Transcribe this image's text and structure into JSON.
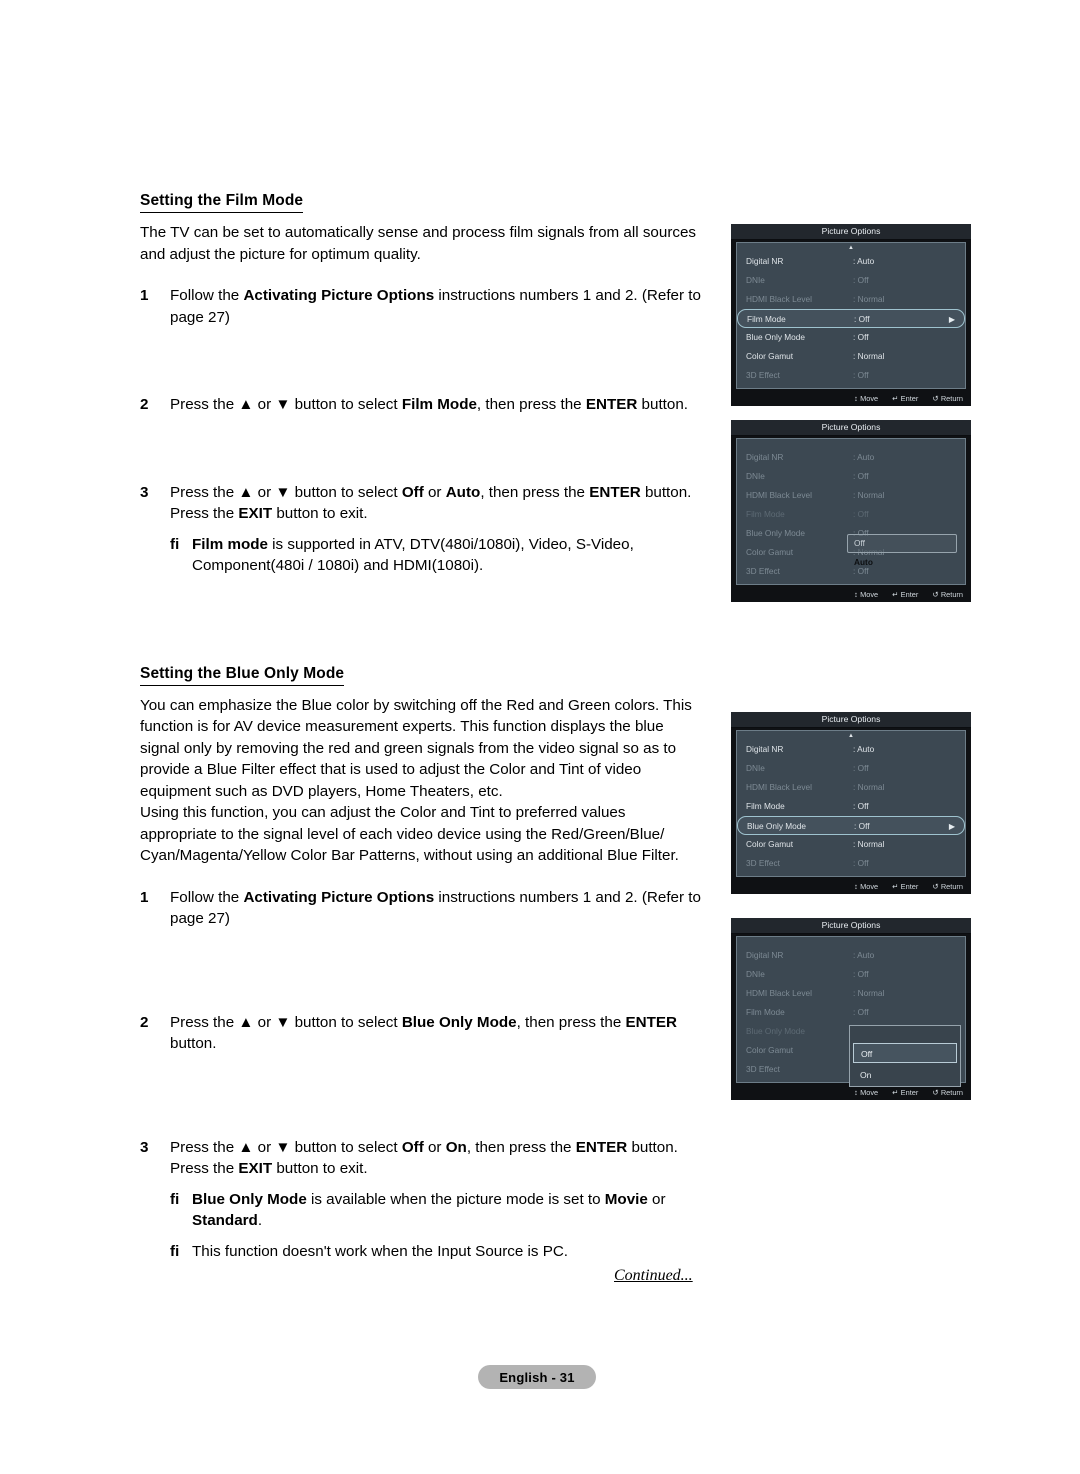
{
  "document": {
    "page_badge": "English - 31",
    "continued": "Continued...",
    "sections": [
      {
        "title": "Setting the Film Mode",
        "intro": "The TV can be set to automatically sense and process film signals from all sources and adjust the picture for optimum quality.",
        "steps": [
          {
            "num": "1",
            "text_parts": [
              {
                "t": "Follow the ",
                "b": false
              },
              {
                "t": "Activating Picture Options",
                "b": true
              },
              {
                "t": " instructions numbers 1 and 2. (Refer to page 27)",
                "b": false
              }
            ]
          },
          {
            "num": "2",
            "text_parts": [
              {
                "t": "Press the ▲ or ▼ button to select ",
                "b": false
              },
              {
                "t": "Film Mode",
                "b": true
              },
              {
                "t": ", then press the ",
                "b": false
              },
              {
                "t": "ENTER",
                "b": true
              },
              {
                "t": " button.",
                "b": false
              }
            ]
          },
          {
            "num": "3",
            "text_parts": [
              {
                "t": "Press the ▲ or ▼ button to select ",
                "b": false
              },
              {
                "t": "Off",
                "b": true
              },
              {
                "t": " or ",
                "b": false
              },
              {
                "t": "Auto",
                "b": true
              },
              {
                "t": ", then press the ",
                "b": false
              },
              {
                "t": "ENTER",
                "b": true
              },
              {
                "t": " button. Press the ",
                "b": false
              },
              {
                "t": "EXIT",
                "b": true
              },
              {
                "t": " button to exit.",
                "b": false
              }
            ]
          }
        ],
        "notes": [
          {
            "mark": "ﬁ",
            "text_parts": [
              {
                "t": "Film mode",
                "b": true
              },
              {
                "t": " is supported in ATV, DTV(480i/1080i), Video, S-Video, Component(480i / 1080i) and HDMI(1080i).",
                "b": false
              }
            ]
          }
        ]
      },
      {
        "title": "Setting the Blue Only Mode",
        "intro": "You can emphasize the Blue color by switching off the Red and Green colors. This function is for AV device measurement experts. This function displays the blue signal only by removing the red and green signals from the video signal so as to provide a Blue Filter effect that is used to adjust the Color and Tint of video equipment such as DVD players, Home Theaters, etc.",
        "intro2": "Using this function, you can adjust the Color and Tint to preferred values appropriate to the signal level of each video device using the Red/Green/Blue/ Cyan/Magenta/Yellow Color Bar Patterns, without using an additional Blue Filter.",
        "steps": [
          {
            "num": "1",
            "text_parts": [
              {
                "t": "Follow the ",
                "b": false
              },
              {
                "t": "Activating Picture Options",
                "b": true
              },
              {
                "t": " instructions numbers 1 and 2. (Refer to page 27)",
                "b": false
              }
            ]
          },
          {
            "num": "2",
            "text_parts": [
              {
                "t": "Press the ▲ or ▼ button to select ",
                "b": false
              },
              {
                "t": "Blue Only Mode",
                "b": true
              },
              {
                "t": ", then press the ",
                "b": false
              },
              {
                "t": "ENTER",
                "b": true
              },
              {
                "t": " button.",
                "b": false
              }
            ]
          },
          {
            "num": "3",
            "text_parts": [
              {
                "t": "Press the ▲ or ▼ button to select ",
                "b": false
              },
              {
                "t": "Off",
                "b": true
              },
              {
                "t": " or ",
                "b": false
              },
              {
                "t": "On",
                "b": true
              },
              {
                "t": ", then press the ",
                "b": false
              },
              {
                "t": "ENTER",
                "b": true
              },
              {
                "t": " button. Press the ",
                "b": false
              },
              {
                "t": "EXIT",
                "b": true
              },
              {
                "t": " button to exit.",
                "b": false
              }
            ]
          }
        ],
        "notes": [
          {
            "mark": "ﬁ",
            "text_parts": [
              {
                "t": "Blue Only Mode",
                "b": true
              },
              {
                "t": " is available when the picture mode is set to ",
                "b": false
              },
              {
                "t": "Movie",
                "b": true
              },
              {
                "t": " or ",
                "b": false
              },
              {
                "t": "Standard",
                "b": true
              },
              {
                "t": ".",
                "b": false
              }
            ]
          },
          {
            "mark": "ﬁ",
            "text_parts": [
              {
                "t": "This function doesn't work when the Input Source is PC.",
                "b": false
              }
            ]
          }
        ]
      }
    ]
  },
  "osd": {
    "title": "Picture Options",
    "footer": {
      "move": "Move",
      "enter": "Enter",
      "return": "Return",
      "move_glyph": "↕",
      "enter_glyph": "↵",
      "return_glyph": "↺"
    },
    "arrow_right_glyph": "▶",
    "up_arrow_glyph": "▲",
    "menus": [
      {
        "id": "menu-film-mode-selected",
        "show_up_arrow": true,
        "rows": [
          {
            "label": "Digital NR",
            "value": ": Auto",
            "state": "normal",
            "selected": false
          },
          {
            "label": "DNIe",
            "value": ": Off",
            "state": "dim",
            "selected": false
          },
          {
            "label": "HDMI Black Level",
            "value": ": Normal",
            "state": "dim",
            "selected": false
          },
          {
            "label": "Film Mode",
            "value": ": Off",
            "state": "normal",
            "selected": true
          },
          {
            "label": "Blue Only Mode",
            "value": ": Off",
            "state": "normal",
            "selected": false
          },
          {
            "label": "Color Gamut",
            "value": ": Normal",
            "state": "normal",
            "selected": false
          },
          {
            "label": "3D Effect",
            "value": ": Off",
            "state": "dim",
            "selected": false
          }
        ],
        "ghost_dropdown": null
      },
      {
        "id": "menu-film-mode-dropdown",
        "show_up_arrow": false,
        "rows": [
          {
            "label": "Digital NR",
            "value": ": Auto",
            "state": "dim",
            "selected": false
          },
          {
            "label": "DNIe",
            "value": ": Off",
            "state": "dim",
            "selected": false
          },
          {
            "label": "HDMI Black Level",
            "value": ": Normal",
            "state": "dim",
            "selected": false
          },
          {
            "label": "Film Mode",
            "value": ": Off",
            "state": "dim2",
            "selected": false
          },
          {
            "label": "Blue Only Mode",
            "value": ": Off",
            "state": "dim",
            "selected": false
          },
          {
            "label": "Color Gamut",
            "value": ": Normal",
            "state": "dim",
            "selected": false
          },
          {
            "label": "3D Effect",
            "value": ": Off",
            "state": "dim",
            "selected": false
          }
        ],
        "ghost_dropdown": {
          "options": [
            "Off",
            "Auto"
          ],
          "selected": "Off"
        }
      },
      {
        "id": "menu-blue-only-selected",
        "show_up_arrow": true,
        "rows": [
          {
            "label": "Digital NR",
            "value": ": Auto",
            "state": "normal",
            "selected": false
          },
          {
            "label": "DNIe",
            "value": ": Off",
            "state": "dim",
            "selected": false
          },
          {
            "label": "HDMI Black Level",
            "value": ": Normal",
            "state": "dim",
            "selected": false
          },
          {
            "label": "Film Mode",
            "value": ": Off",
            "state": "normal",
            "selected": false
          },
          {
            "label": "Blue Only Mode",
            "value": ": Off",
            "state": "normal",
            "selected": true
          },
          {
            "label": "Color Gamut",
            "value": ": Normal",
            "state": "normal",
            "selected": false
          },
          {
            "label": "3D Effect",
            "value": ": Off",
            "state": "dim",
            "selected": false
          }
        ],
        "ghost_dropdown": null
      },
      {
        "id": "menu-blue-only-dropdown",
        "show_up_arrow": false,
        "rows": [
          {
            "label": "Digital NR",
            "value": ": Auto",
            "state": "dim",
            "selected": false
          },
          {
            "label": "DNIe",
            "value": ": Off",
            "state": "dim",
            "selected": false
          },
          {
            "label": "HDMI Black Level",
            "value": ": Normal",
            "state": "dim",
            "selected": false
          },
          {
            "label": "Film Mode",
            "value": ": Off",
            "state": "dim",
            "selected": false
          },
          {
            "label": "Blue Only Mode",
            "value": ": Off",
            "state": "dim2",
            "selected": false
          },
          {
            "label": "Color Gamut",
            "value": ": Normal",
            "state": "dim",
            "selected": false
          },
          {
            "label": "3D Effect",
            "value": ": Off",
            "state": "dim",
            "selected": false
          }
        ],
        "panel_dropdown": {
          "options": [
            "Off",
            "On"
          ],
          "selected": "Off"
        }
      }
    ]
  },
  "colors": {
    "osd_bg": "#0f1114",
    "osd_panel": "#3c4852",
    "osd_border": "#6d7d88",
    "osd_title_bg": "#22272d",
    "highlight_border": "#9fc3cf",
    "badge_bg": "#b3b3b3"
  }
}
